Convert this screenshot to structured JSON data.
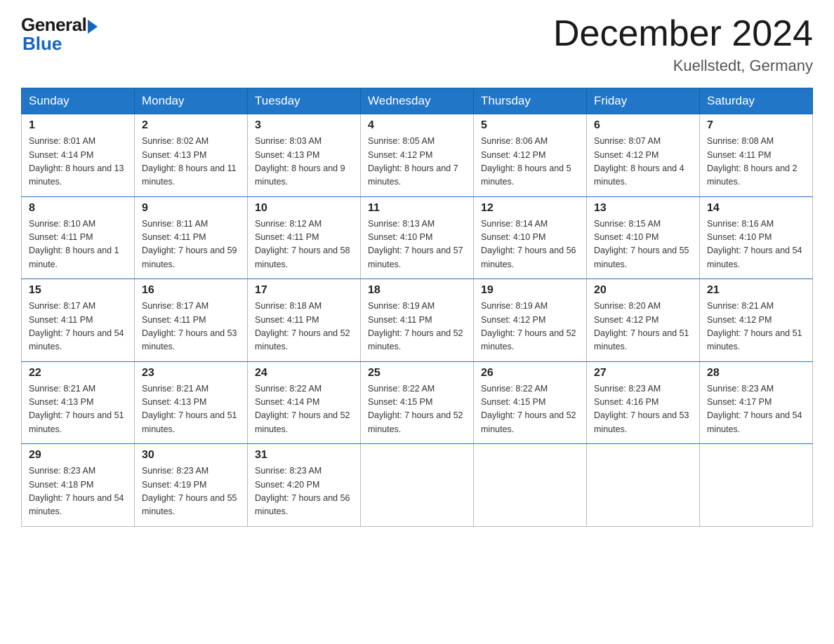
{
  "logo": {
    "general": "General",
    "blue": "Blue"
  },
  "title": "December 2024",
  "subtitle": "Kuellstedt, Germany",
  "days_header": [
    "Sunday",
    "Monday",
    "Tuesday",
    "Wednesday",
    "Thursday",
    "Friday",
    "Saturday"
  ],
  "weeks": [
    [
      {
        "num": "1",
        "sunrise": "8:01 AM",
        "sunset": "4:14 PM",
        "daylight": "8 hours and 13 minutes."
      },
      {
        "num": "2",
        "sunrise": "8:02 AM",
        "sunset": "4:13 PM",
        "daylight": "8 hours and 11 minutes."
      },
      {
        "num": "3",
        "sunrise": "8:03 AM",
        "sunset": "4:13 PM",
        "daylight": "8 hours and 9 minutes."
      },
      {
        "num": "4",
        "sunrise": "8:05 AM",
        "sunset": "4:12 PM",
        "daylight": "8 hours and 7 minutes."
      },
      {
        "num": "5",
        "sunrise": "8:06 AM",
        "sunset": "4:12 PM",
        "daylight": "8 hours and 5 minutes."
      },
      {
        "num": "6",
        "sunrise": "8:07 AM",
        "sunset": "4:12 PM",
        "daylight": "8 hours and 4 minutes."
      },
      {
        "num": "7",
        "sunrise": "8:08 AM",
        "sunset": "4:11 PM",
        "daylight": "8 hours and 2 minutes."
      }
    ],
    [
      {
        "num": "8",
        "sunrise": "8:10 AM",
        "sunset": "4:11 PM",
        "daylight": "8 hours and 1 minute."
      },
      {
        "num": "9",
        "sunrise": "8:11 AM",
        "sunset": "4:11 PM",
        "daylight": "7 hours and 59 minutes."
      },
      {
        "num": "10",
        "sunrise": "8:12 AM",
        "sunset": "4:11 PM",
        "daylight": "7 hours and 58 minutes."
      },
      {
        "num": "11",
        "sunrise": "8:13 AM",
        "sunset": "4:10 PM",
        "daylight": "7 hours and 57 minutes."
      },
      {
        "num": "12",
        "sunrise": "8:14 AM",
        "sunset": "4:10 PM",
        "daylight": "7 hours and 56 minutes."
      },
      {
        "num": "13",
        "sunrise": "8:15 AM",
        "sunset": "4:10 PM",
        "daylight": "7 hours and 55 minutes."
      },
      {
        "num": "14",
        "sunrise": "8:16 AM",
        "sunset": "4:10 PM",
        "daylight": "7 hours and 54 minutes."
      }
    ],
    [
      {
        "num": "15",
        "sunrise": "8:17 AM",
        "sunset": "4:11 PM",
        "daylight": "7 hours and 54 minutes."
      },
      {
        "num": "16",
        "sunrise": "8:17 AM",
        "sunset": "4:11 PM",
        "daylight": "7 hours and 53 minutes."
      },
      {
        "num": "17",
        "sunrise": "8:18 AM",
        "sunset": "4:11 PM",
        "daylight": "7 hours and 52 minutes."
      },
      {
        "num": "18",
        "sunrise": "8:19 AM",
        "sunset": "4:11 PM",
        "daylight": "7 hours and 52 minutes."
      },
      {
        "num": "19",
        "sunrise": "8:19 AM",
        "sunset": "4:12 PM",
        "daylight": "7 hours and 52 minutes."
      },
      {
        "num": "20",
        "sunrise": "8:20 AM",
        "sunset": "4:12 PM",
        "daylight": "7 hours and 51 minutes."
      },
      {
        "num": "21",
        "sunrise": "8:21 AM",
        "sunset": "4:12 PM",
        "daylight": "7 hours and 51 minutes."
      }
    ],
    [
      {
        "num": "22",
        "sunrise": "8:21 AM",
        "sunset": "4:13 PM",
        "daylight": "7 hours and 51 minutes."
      },
      {
        "num": "23",
        "sunrise": "8:21 AM",
        "sunset": "4:13 PM",
        "daylight": "7 hours and 51 minutes."
      },
      {
        "num": "24",
        "sunrise": "8:22 AM",
        "sunset": "4:14 PM",
        "daylight": "7 hours and 52 minutes."
      },
      {
        "num": "25",
        "sunrise": "8:22 AM",
        "sunset": "4:15 PM",
        "daylight": "7 hours and 52 minutes."
      },
      {
        "num": "26",
        "sunrise": "8:22 AM",
        "sunset": "4:15 PM",
        "daylight": "7 hours and 52 minutes."
      },
      {
        "num": "27",
        "sunrise": "8:23 AM",
        "sunset": "4:16 PM",
        "daylight": "7 hours and 53 minutes."
      },
      {
        "num": "28",
        "sunrise": "8:23 AM",
        "sunset": "4:17 PM",
        "daylight": "7 hours and 54 minutes."
      }
    ],
    [
      {
        "num": "29",
        "sunrise": "8:23 AM",
        "sunset": "4:18 PM",
        "daylight": "7 hours and 54 minutes."
      },
      {
        "num": "30",
        "sunrise": "8:23 AM",
        "sunset": "4:19 PM",
        "daylight": "7 hours and 55 minutes."
      },
      {
        "num": "31",
        "sunrise": "8:23 AM",
        "sunset": "4:20 PM",
        "daylight": "7 hours and 56 minutes."
      },
      null,
      null,
      null,
      null
    ]
  ]
}
